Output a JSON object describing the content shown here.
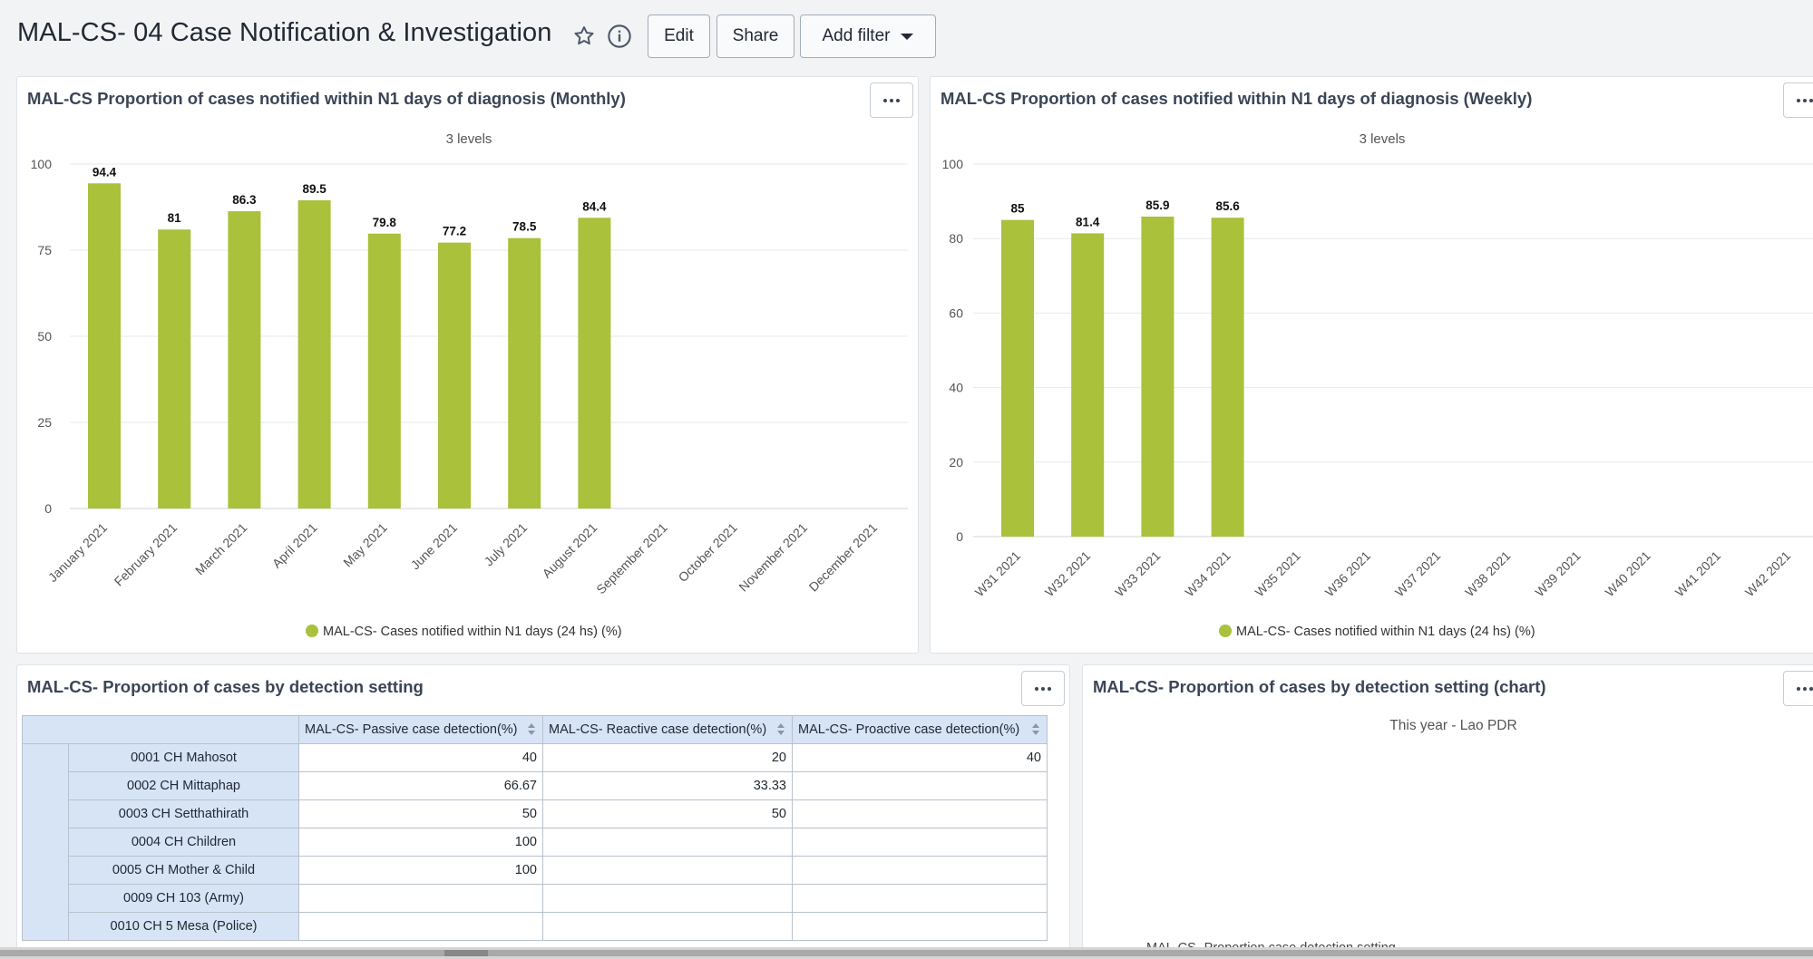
{
  "dashboard": {
    "title": "MAL-CS- 04 Case Notification & Investigation",
    "edit_label": "Edit",
    "share_label": "Share",
    "add_filter_label": "Add filter"
  },
  "colors": {
    "bar": "#a9c13b",
    "grid": "#e8ebef",
    "accent": "#212934"
  },
  "monthly": {
    "title": "MAL-CS Proportion of cases notified within N1 days of diagnosis (Monthly)",
    "subtitle": "3 levels",
    "legend": "MAL-CS- Cases notified within N1 days (24 hs) (%)"
  },
  "weekly": {
    "title": "MAL-CS Proportion of cases notified within N1 days of diagnosis (Weekly)",
    "subtitle": "3 levels",
    "legend": "MAL-CS- Cases notified within N1 days (24 hs) (%)"
  },
  "table": {
    "title": "MAL-CS- Proportion of cases by detection setting",
    "columns": [
      "MAL-CS- Passive case detection(%)",
      "MAL-CS- Reactive case detection(%)",
      "MAL-CS- Proactive case detection(%)"
    ],
    "rows": [
      {
        "name": "0001 CH Mahosot",
        "values": [
          "40",
          "20",
          "40"
        ]
      },
      {
        "name": "0002 CH Mittaphap",
        "values": [
          "66.67",
          "33.33",
          ""
        ]
      },
      {
        "name": "0003 CH Setthathirath",
        "values": [
          "50",
          "50",
          ""
        ]
      },
      {
        "name": "0004 CH Children",
        "values": [
          "100",
          "",
          ""
        ]
      },
      {
        "name": "0005 CH Mother & Child",
        "values": [
          "100",
          "",
          ""
        ]
      },
      {
        "name": "0009 CH 103 (Army)",
        "values": [
          "",
          "",
          ""
        ]
      },
      {
        "name": "0010 CH 5 Mesa (Police)",
        "values": [
          "",
          "",
          ""
        ]
      }
    ]
  },
  "detection_chart": {
    "title": "MAL-CS- Proportion of cases by detection setting (chart)",
    "subtitle": "This year - Lao PDR",
    "cutoff_label": "MAL-CS- Proportion case detection setting"
  },
  "chart_data": [
    {
      "type": "bar",
      "title": "MAL-CS Proportion of cases notified within N1 days of diagnosis (Monthly)",
      "subtitle": "3 levels",
      "categories": [
        "January 2021",
        "February 2021",
        "March 2021",
        "April 2021",
        "May 2021",
        "June 2021",
        "July 2021",
        "August 2021",
        "September 2021",
        "October 2021",
        "November 2021",
        "December 2021"
      ],
      "series": [
        {
          "name": "MAL-CS- Cases notified within N1 days (24 hs) (%)",
          "values": [
            94.4,
            81,
            86.3,
            89.5,
            79.8,
            77.2,
            78.5,
            84.4,
            null,
            null,
            null,
            null
          ]
        }
      ],
      "ylim": [
        0,
        100
      ],
      "yticks": [
        0,
        25,
        50,
        75,
        100
      ],
      "grid": true,
      "legend": "bottom-center"
    },
    {
      "type": "bar",
      "title": "MAL-CS Proportion of cases notified within N1 days of diagnosis (Weekly)",
      "subtitle": "3 levels",
      "categories": [
        "W31 2021",
        "W32 2021",
        "W33 2021",
        "W34 2021",
        "W35 2021",
        "W36 2021",
        "W37 2021",
        "W38 2021",
        "W39 2021",
        "W40 2021",
        "W41 2021",
        "W42 2021"
      ],
      "series": [
        {
          "name": "MAL-CS- Cases notified within N1 days (24 hs) (%)",
          "values": [
            85,
            81.4,
            85.9,
            85.6,
            null,
            null,
            null,
            null,
            null,
            null,
            null,
            null
          ]
        }
      ],
      "ylim": [
        0,
        100
      ],
      "yticks": [
        0,
        20,
        40,
        60,
        80,
        100
      ],
      "grid": true,
      "legend": "bottom-center"
    }
  ]
}
